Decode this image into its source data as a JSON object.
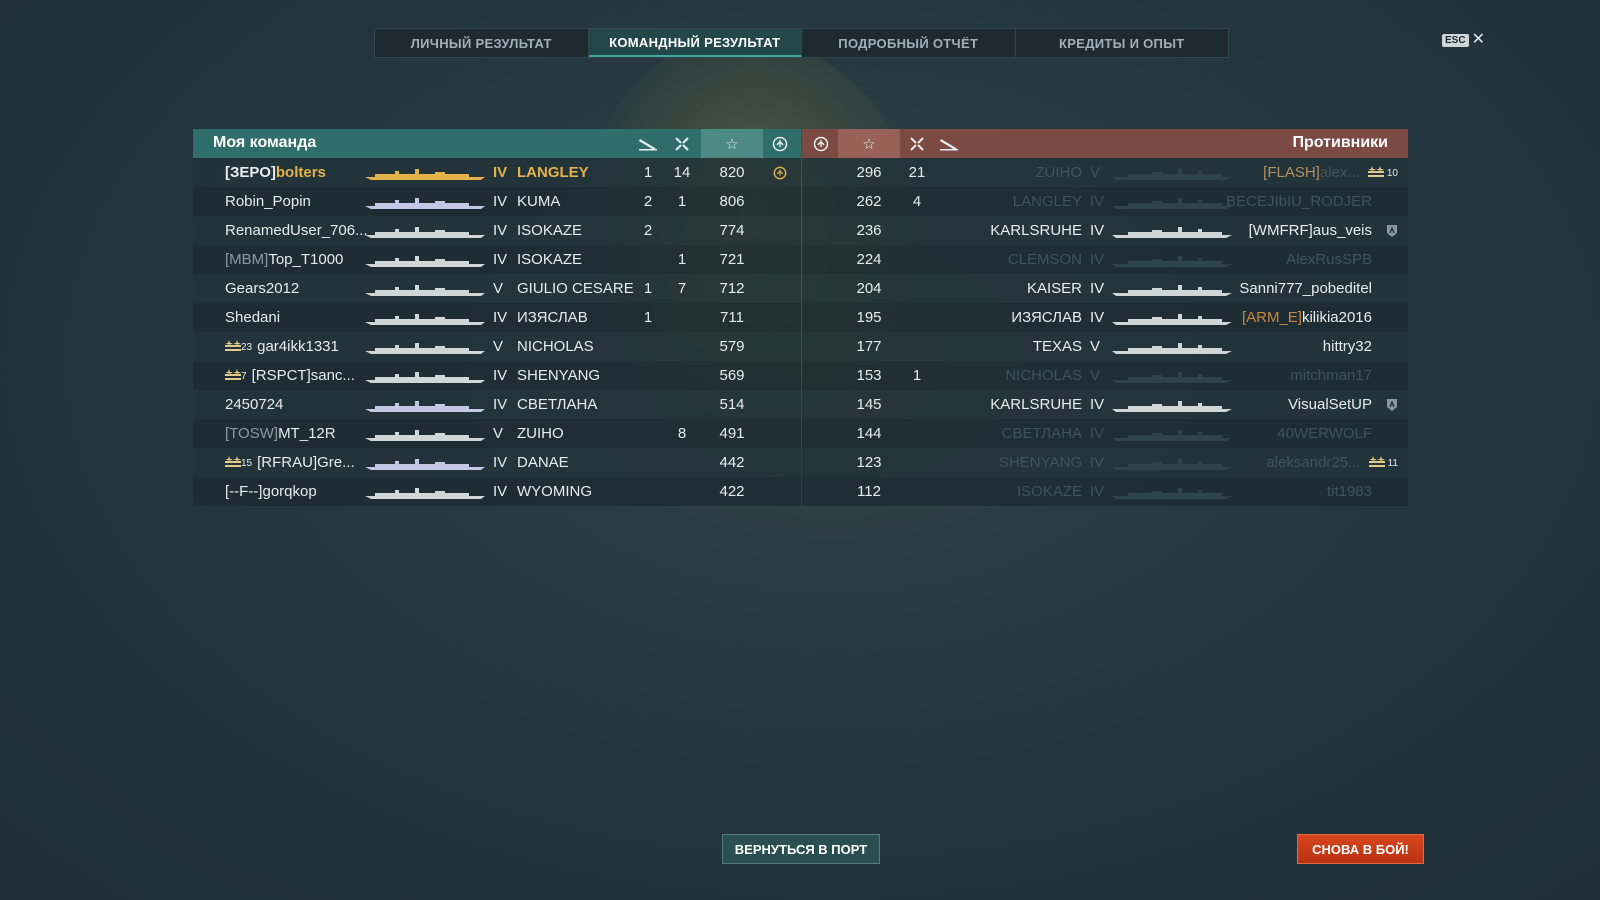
{
  "tabs": [
    "ЛИЧНЫЙ РЕЗУЛЬТАТ",
    "КОМАНДНЫЙ РЕЗУЛЬТАТ",
    "ПОДРОБНЫЙ ОТЧЁТ",
    "КРЕДИТЫ И ОПЫТ"
  ],
  "active_tab": 1,
  "esc_label": "ESC",
  "close_glyph": "✕",
  "header": {
    "my_team": "Моя команда",
    "enemies": "Противники",
    "icons": [
      "torpedo-icon",
      "frags-icon",
      "star-icon",
      "base-capture-icon"
    ]
  },
  "my_team": [
    {
      "prefix": "[ЗЕРО]",
      "name": "bolters",
      "tier": "IV",
      "ship": "LANGLEY",
      "c1": "1",
      "c2": "14",
      "score": "820",
      "capture": true,
      "highlight": true,
      "ship_color": "#e4b24a"
    },
    {
      "prefix": "",
      "name": "Robin_Popin",
      "tier": "IV",
      "ship": "KUMA",
      "c1": "2",
      "c2": "1",
      "score": "806",
      "ship_color": "#c2c8e6"
    },
    {
      "prefix": "",
      "name": "RenamedUser_706...",
      "tier": "IV",
      "ship": "ISOKAZE",
      "c1": "2",
      "c2": "",
      "score": "774",
      "ship_color": "#cfd6d8"
    },
    {
      "prefix": "[MBM]",
      "name": "Top_T1000",
      "tier": "IV",
      "ship": "ISOKAZE",
      "c1": "",
      "c2": "1",
      "score": "721",
      "ship_color": "#cfd6d8"
    },
    {
      "prefix": "",
      "name": "Gears2012",
      "tier": "V",
      "ship": "GIULIO CESARE",
      "c1": "1",
      "c2": "7",
      "score": "712",
      "ship_color": "#cfd6d8"
    },
    {
      "prefix": "",
      "name": "Shedani",
      "tier": "IV",
      "ship": "ИЗЯСЛАВ",
      "c1": "1",
      "c2": "",
      "score": "711",
      "ship_color": "#cfd6d8"
    },
    {
      "prefix": "",
      "badge": "23",
      "name": "gar4ikk1331",
      "tier": "V",
      "ship": "NICHOLAS",
      "c1": "",
      "c2": "",
      "score": "579",
      "ship_color": "#cfd6d8"
    },
    {
      "prefix": "",
      "badge": "7",
      "name": "[RSPCT]sanc...",
      "tier": "IV",
      "ship": "SHENYANG",
      "c1": "",
      "c2": "",
      "score": "569",
      "ship_color": "#cfd6d8"
    },
    {
      "prefix": "",
      "name": "2450724",
      "tier": "IV",
      "ship": "СВЕТЛАНА",
      "c1": "",
      "c2": "",
      "score": "514",
      "ship_color": "#c2c8e6"
    },
    {
      "prefix": "[TOSW]",
      "name": "MT_12R",
      "tier": "V",
      "ship": "ZUIHO",
      "c1": "",
      "c2": "8",
      "score": "491",
      "ship_color": "#cfd6d8"
    },
    {
      "prefix": "",
      "badge": "15",
      "name": "[RFRAU]Gre...",
      "tier": "IV",
      "ship": "DANAE",
      "c1": "",
      "c2": "",
      "score": "442",
      "ship_color": "#c2c8e6"
    },
    {
      "prefix": "",
      "name": "[--F--]gorqkop",
      "tier": "IV",
      "ship": "WYOMING",
      "c1": "",
      "c2": "",
      "score": "422",
      "ship_color": "#cfd6d8"
    }
  ],
  "enemies": [
    {
      "score": "296",
      "frags": "21",
      "ship": "ZUIHO",
      "tier": "V",
      "prefix": "[FLASH]",
      "name": "alex...",
      "badge": "10",
      "alive": false
    },
    {
      "score": "262",
      "frags": "4",
      "ship": "LANGLEY",
      "tier": "IV",
      "prefix": "",
      "name": "BECEJIbIU_RODJER",
      "alive": false
    },
    {
      "score": "236",
      "frags": "",
      "ship": "KARLSRUHE",
      "tier": "IV",
      "prefix": "",
      "name": "[WMFRF]aus_veis",
      "division": true,
      "alive": true
    },
    {
      "score": "224",
      "frags": "",
      "ship": "CLEMSON",
      "tier": "IV",
      "prefix": "",
      "name": "AlexRusSPB",
      "alive": false
    },
    {
      "score": "204",
      "frags": "",
      "ship": "KAISER",
      "tier": "IV",
      "prefix": "",
      "name": "Sanni777_pobeditel",
      "alive": true
    },
    {
      "score": "195",
      "frags": "",
      "ship": "ИЗЯСЛАВ",
      "tier": "IV",
      "prefix": "[ARM_E]",
      "name": "kilikia2016",
      "alive": true
    },
    {
      "score": "177",
      "frags": "",
      "ship": "TEXAS",
      "tier": "V",
      "prefix": "",
      "name": "hittry32",
      "alive": true
    },
    {
      "score": "153",
      "frags": "1",
      "ship": "NICHOLAS",
      "tier": "V",
      "prefix": "",
      "name": "mitchman17",
      "alive": false
    },
    {
      "score": "145",
      "frags": "",
      "ship": "KARLSRUHE",
      "tier": "IV",
      "prefix": "",
      "name": "VisualSetUP",
      "division": true,
      "alive": true
    },
    {
      "score": "144",
      "frags": "",
      "ship": "СВЕТЛАНА",
      "tier": "IV",
      "prefix": "",
      "name": "40WERWOLF",
      "alive": false
    },
    {
      "score": "123",
      "frags": "",
      "ship": "SHENYANG",
      "tier": "IV",
      "prefix": "",
      "name": "aleksandr25...",
      "badge": "11",
      "alive": false
    },
    {
      "score": "112",
      "frags": "",
      "ship": "ISOKAZE",
      "tier": "IV",
      "prefix": "",
      "name": "tit1983",
      "alive": false
    }
  ],
  "buttons": {
    "port": "ВЕРНУТЬСЯ В ПОРТ",
    "battle": "СНОВА В БОЙ!"
  },
  "colors": {
    "my_header": "#2f6e6a",
    "enemy_header": "#7b4a42",
    "highlight": "#e4b24a",
    "battle_button": "#c93a16"
  }
}
